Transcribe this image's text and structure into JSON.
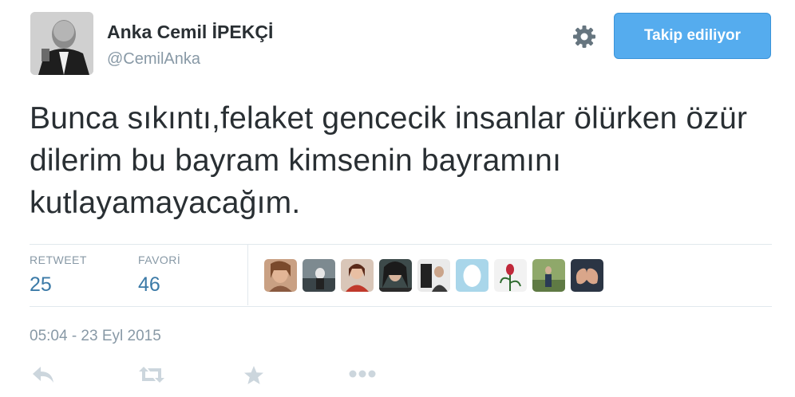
{
  "user": {
    "name": "Anka Cemil İPEKÇİ",
    "handle": "@CemilAnka"
  },
  "follow_button": {
    "label": "Takip ediliyor"
  },
  "tweet": {
    "text": "Bunca sıkıntı,felaket gencecik insanlar ölürken özür dilerim bu bayram kimsenin bayramını kutlayamayacağım."
  },
  "stats": {
    "retweet_label": "RETWEET",
    "retweet_count": "25",
    "favorite_label": "FAVORİ",
    "favorite_count": "46"
  },
  "timestamp": "05:04 - 23 Eyl 2015",
  "favoriters_count": 9,
  "icons": {
    "settings": "gear-icon",
    "reply": "reply-icon",
    "retweet": "retweet-icon",
    "favorite": "star-icon",
    "more": "more-icon"
  },
  "colors": {
    "follow_button": "#55acee",
    "stat_value": "#3b7aa7",
    "muted": "#8899a6",
    "action_icon": "#ccd6dd"
  }
}
